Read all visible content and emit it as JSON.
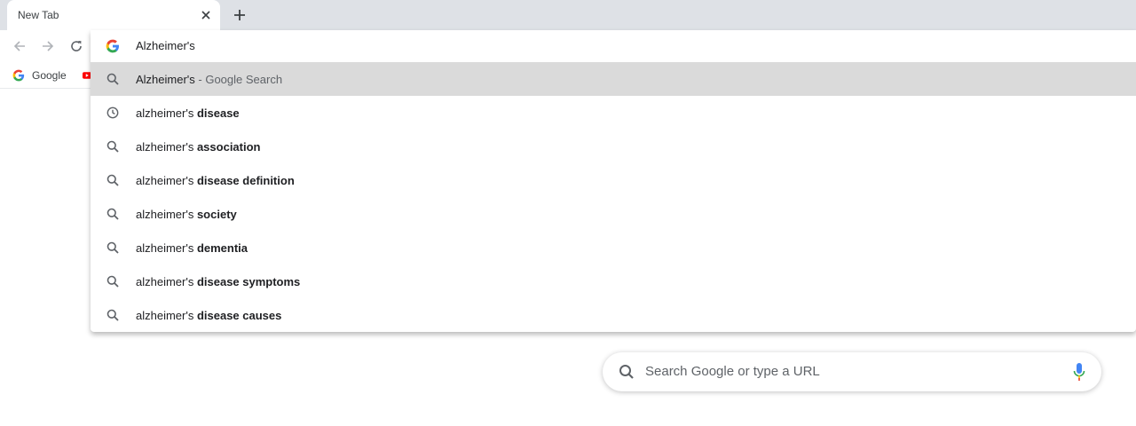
{
  "tab": {
    "title": "New Tab"
  },
  "bookmarks": {
    "google_label": "Google"
  },
  "omnibox": {
    "input_value": "Alzheimer's",
    "suggestions": [
      {
        "icon": "search-icon",
        "plain": "Alzheimer's",
        "sep": " - ",
        "desc": "Google Search",
        "bold": "",
        "selected": true
      },
      {
        "icon": "history-icon",
        "plain": "alzheimer's ",
        "bold": "disease"
      },
      {
        "icon": "search-icon",
        "plain": "alzheimer's ",
        "bold": "association"
      },
      {
        "icon": "search-icon",
        "plain": "alzheimer's ",
        "bold": "disease definition"
      },
      {
        "icon": "search-icon",
        "plain": "alzheimer's ",
        "bold": "society"
      },
      {
        "icon": "search-icon",
        "plain": "alzheimer's ",
        "bold": "dementia"
      },
      {
        "icon": "search-icon",
        "plain": "alzheimer's ",
        "bold": "disease symptoms"
      },
      {
        "icon": "search-icon",
        "plain": "alzheimer's ",
        "bold": "disease causes"
      }
    ]
  },
  "ntp": {
    "search_placeholder": "Search Google or type a URL"
  },
  "colors": {
    "tabstrip": "#dee1e6",
    "selected_row": "#dadada",
    "icon_gray": "#5f6368",
    "google_blue": "#4285f4",
    "google_red": "#ea4335",
    "google_yellow": "#fbbc05",
    "google_green": "#34a853"
  }
}
